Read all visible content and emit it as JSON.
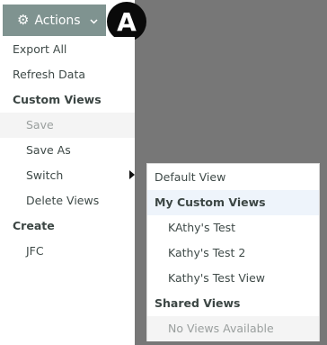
{
  "toolbar": {
    "actions_label": "Actions",
    "button_color": "#7f9390"
  },
  "badge": {
    "letter": "A"
  },
  "menu": {
    "export_all": "Export All",
    "refresh_data": "Refresh Data",
    "custom_views_header": "Custom Views",
    "save": "Save",
    "save_as": "Save As",
    "switch": "Switch",
    "delete_views": "Delete Views",
    "create_header": "Create",
    "jfc": "JFC"
  },
  "submenu": {
    "default_view": "Default View",
    "my_custom_views_header": "My Custom Views",
    "views": [
      "KAthy's Test",
      "Kathy's Test 2",
      "Kathy's Test View"
    ],
    "shared_views_header": "Shared Views",
    "no_views": "No Views Available"
  },
  "icons": {
    "gear": "gear-icon",
    "chevron": "chevron-down-icon",
    "submenu_arrow": "caret-right-icon"
  }
}
